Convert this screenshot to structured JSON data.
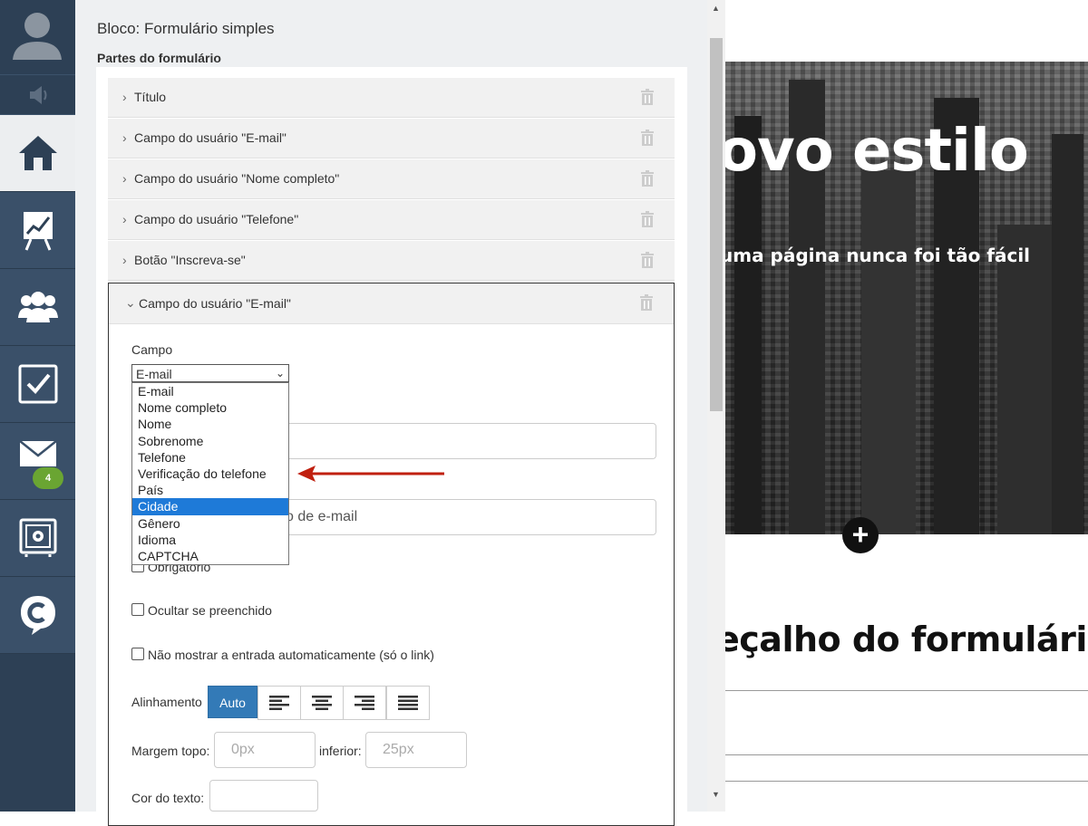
{
  "nav": {
    "badge_count": "4",
    "items": [
      "home",
      "analytics",
      "contacts",
      "tasks",
      "messages",
      "settings",
      "chat"
    ]
  },
  "panel": {
    "block_title": "Bloco: Formulário simples",
    "parts_label": "Partes do formulário",
    "parts": [
      "Título",
      "Campo do usuário \"E-mail\"",
      "Campo do usuário \"Nome completo\"",
      "Campo do usuário \"Telefone\"",
      "Botão \"Inscreva-se\""
    ],
    "expanded_part": "Campo do usuário \"E-mail\"",
    "campo_label": "Campo",
    "campo_value": "E-mail",
    "dropdown_options": [
      "E-mail",
      "Nome completo",
      "Nome",
      "Sobrenome",
      "Telefone",
      "Verificação do telefone",
      "País",
      "Cidade",
      "Gênero",
      "Idioma",
      "CAPTCHA"
    ],
    "dropdown_selected": "Cidade",
    "placeholder_input_text": "o de e-mail",
    "obrigatorio_label": "Obrigatório",
    "ocultar_label": "Ocultar se preenchido",
    "nao_mostrar_label": "Não mostrar a entrada automaticamente (só o link)",
    "alinhamento_label": "Alinhamento",
    "align_auto": "Auto",
    "margem_topo_label": "Margem topo:",
    "margem_topo_placeholder": "0px",
    "inferior_label": "inferior:",
    "inferior_placeholder": "25px",
    "cor_texto_label": "Cor do texto:"
  },
  "preview": {
    "hero_title": "ovo estilo",
    "hero_subtitle": "uma página nunca foi tão fácil",
    "form_heading": "eçalho do formulário"
  },
  "colors": {
    "nav_bg": "#3a5069",
    "accent_blue": "#337ab7",
    "selected_option": "#1e7ad8",
    "badge_green": "#6aa532",
    "arrow_red": "#c0200f"
  }
}
